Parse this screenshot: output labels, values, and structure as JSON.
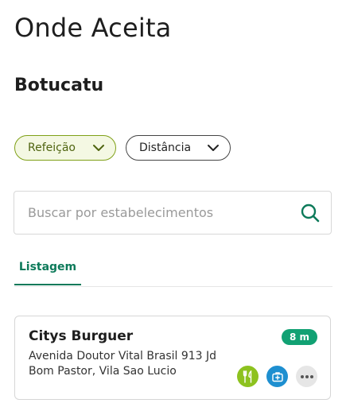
{
  "header": {
    "title": "Onde Aceita",
    "city": "Botucatu"
  },
  "filters": {
    "meal_label": "Refeição",
    "distance_label": "Distância"
  },
  "search": {
    "placeholder": "Buscar por estabelecimentos",
    "value": ""
  },
  "tabs": [
    {
      "label": "Listagem",
      "active": true
    }
  ],
  "listing": {
    "items": [
      {
        "name": "Citys Burguer",
        "address_line1": "Avenida Doutor Vital Brasil 913 Jd",
        "address_line2": "Bom Pastor, Vila Sao Lucio",
        "distance": "8 m",
        "icons": [
          "fork-knife-icon",
          "medical-kit-icon",
          "more-icon"
        ]
      }
    ]
  },
  "colors": {
    "brand_green": "#0d7a5a",
    "meal_green": "#8dc21f",
    "health_blue": "#1e8fd0",
    "badge_green": "#11a173"
  }
}
